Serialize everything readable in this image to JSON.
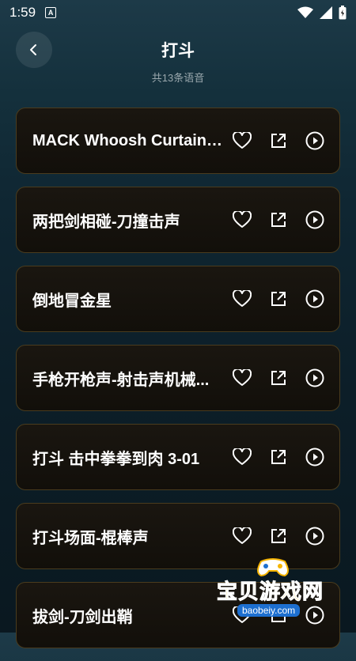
{
  "status": {
    "time": "1:59",
    "a_label": "A"
  },
  "header": {
    "title": "打斗",
    "subtitle": "共13条语音"
  },
  "items": [
    {
      "label": "MACK Whoosh Curtain ..."
    },
    {
      "label": "两把剑相碰-刀撞击声"
    },
    {
      "label": "倒地冒金星"
    },
    {
      "label": "手枪开枪声-射击声机械..."
    },
    {
      "label": "打斗 击中拳拳到肉 3-01"
    },
    {
      "label": "打斗场面-棍棒声"
    },
    {
      "label": "拔剑-刀剑出鞘"
    }
  ],
  "icons": {
    "favorite": "heart-icon",
    "share": "share-icon",
    "play": "play-icon",
    "back": "chevron-left-icon"
  },
  "watermark": {
    "text": "宝贝游戏网",
    "url": "baobeiy.com"
  },
  "colors": {
    "accent_border": "#4a3c1e",
    "card_bg": "#15120c",
    "text": "#ffffff",
    "subtitle": "#9aa7ad"
  }
}
